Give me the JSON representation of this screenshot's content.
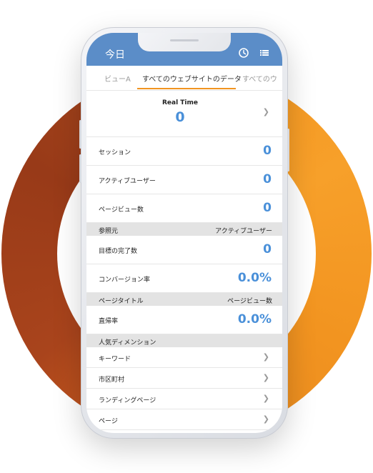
{
  "header": {
    "title": "今日",
    "clock_icon": "clock-icon",
    "list_icon": "list-icon"
  },
  "tabs": [
    {
      "label": "ビューA",
      "active": false
    },
    {
      "label": "すべてのウェブサイトのデータ",
      "active": true
    },
    {
      "label": "すべてのウ",
      "active": false
    }
  ],
  "realtime": {
    "label": "Real Time",
    "value": "0"
  },
  "metrics": [
    {
      "label": "セッション",
      "value": "0"
    },
    {
      "label": "アクティブユーザー",
      "value": "0"
    },
    {
      "label": "ページビュー数",
      "value": "0"
    }
  ],
  "section1": {
    "left": "参照元",
    "right": "アクティブユーザー"
  },
  "goals": [
    {
      "label": "目標の完了数",
      "value": "0"
    },
    {
      "label": "コンバージョン率",
      "value": "0.0%"
    }
  ],
  "section2": {
    "left": "ページタイトル",
    "right": "ページビュー数"
  },
  "bounce": {
    "label": "直帰率",
    "value": "0.0%"
  },
  "section3": {
    "left": "人気ディメンション"
  },
  "dimensions": [
    {
      "label": "キーワード"
    },
    {
      "label": "市区町村"
    },
    {
      "label": "ランディングページ"
    },
    {
      "label": "ページ"
    }
  ],
  "colors": {
    "accent": "#4a90d9",
    "header": "#5b8dc8",
    "tab_underline": "#f29420",
    "ring_orange": "#f4941e",
    "ring_brown": "#983a18"
  }
}
